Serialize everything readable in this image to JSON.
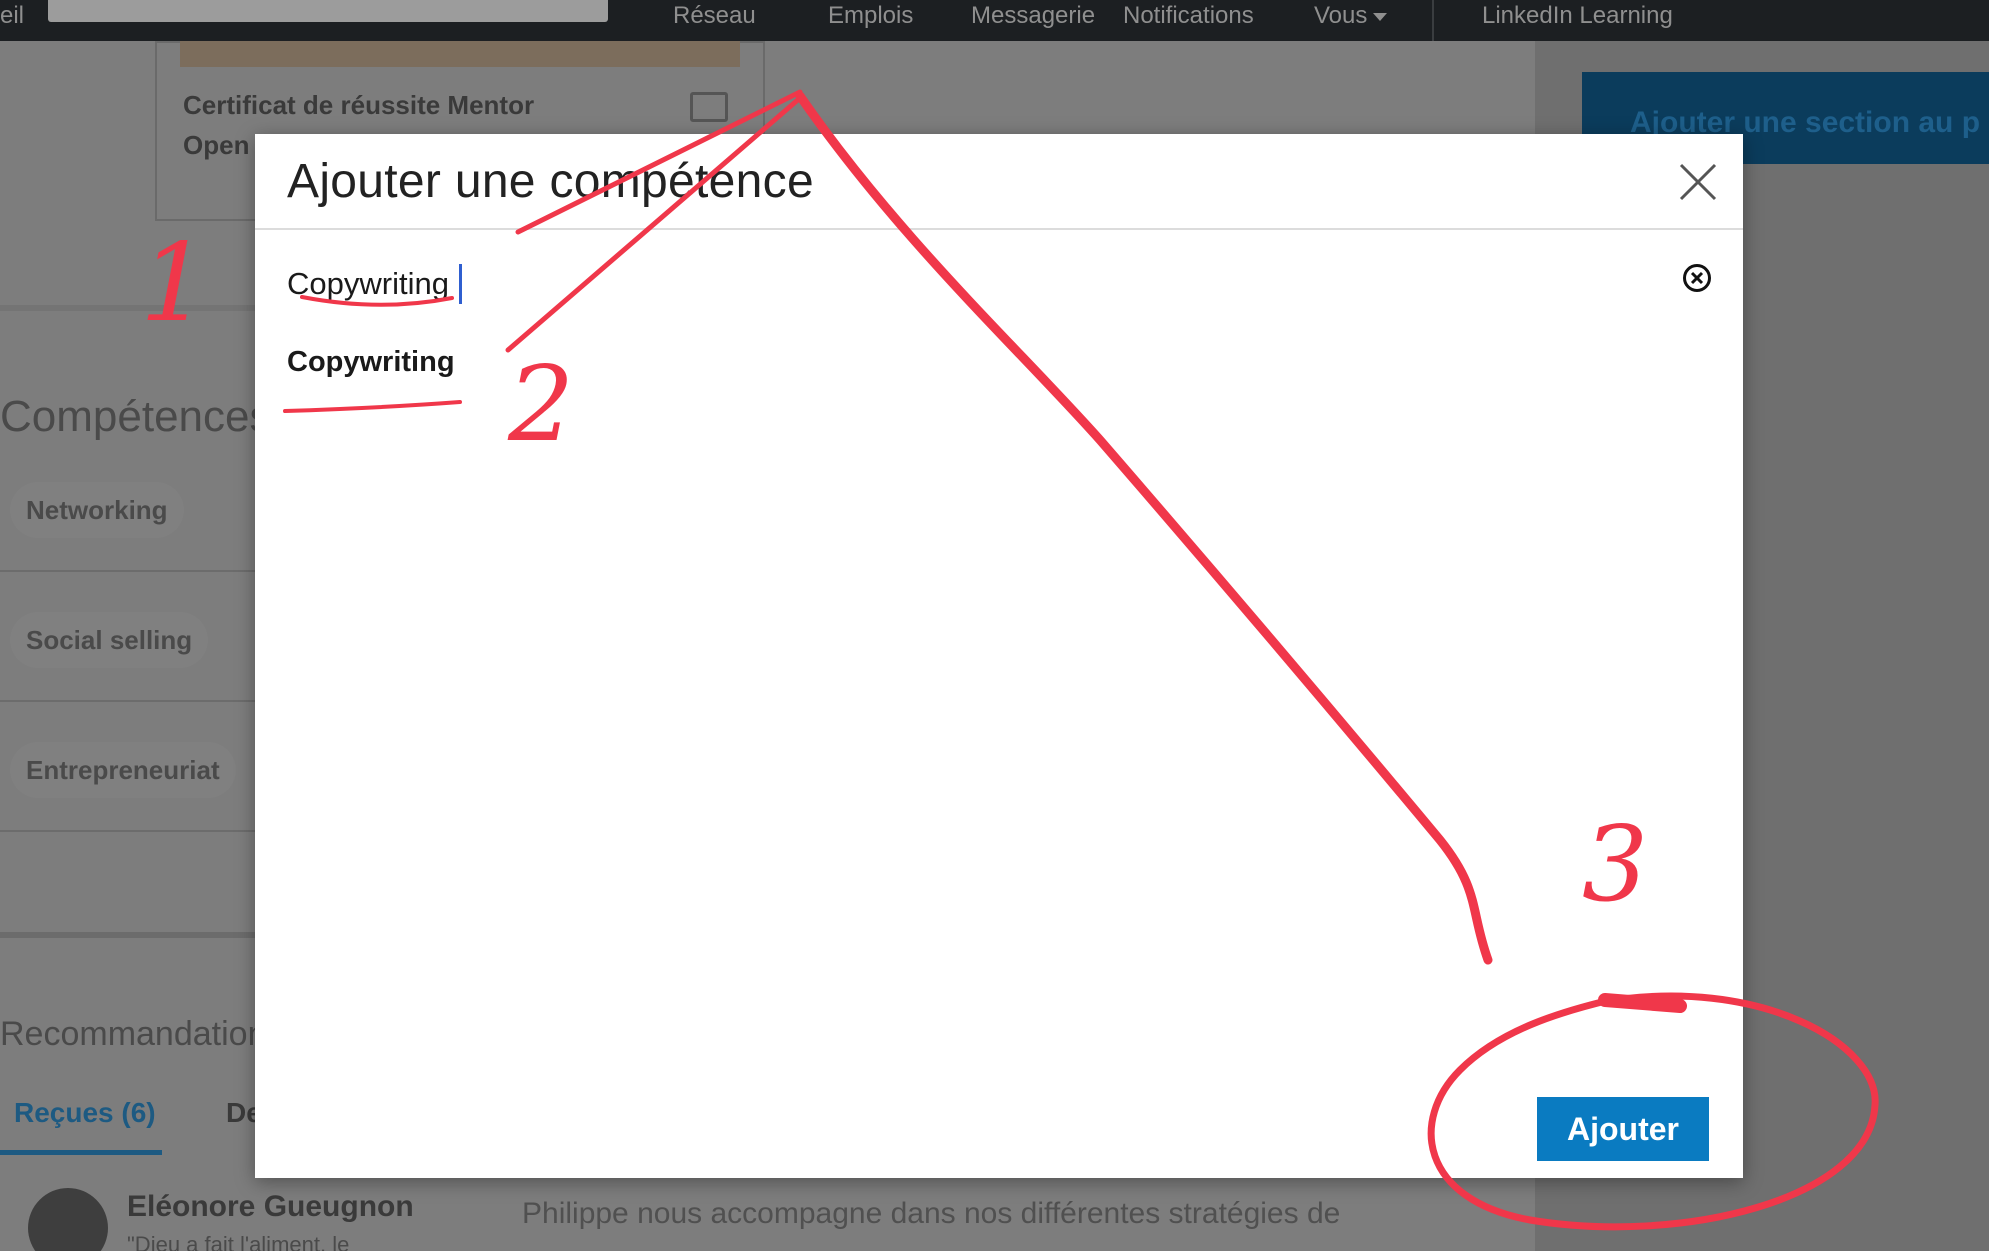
{
  "nav": {
    "home_fragment": "eil",
    "items": [
      "Réseau",
      "Emplois",
      "Messagerie",
      "Notifications",
      "Vous",
      "LinkedIn Learning"
    ]
  },
  "background": {
    "cert_title": "Certificat de réussite Mentor",
    "cert_sub": "Open",
    "skills_title": "Compétences et",
    "skills": [
      "Networking",
      "Social selling",
      "Entrepreneuriat"
    ],
    "reco_title": "Recommandations",
    "tabs": [
      "Reçues (6)",
      "De"
    ],
    "person_name": "Eléonore Gueugnon",
    "person_sub": "\"Dieu a fait l'aliment, le",
    "quote": "Philippe nous accompagne dans nos différentes stratégies de",
    "side_button": "Ajouter une section au p"
  },
  "modal": {
    "title": "Ajouter une compétence",
    "input_value": "Copywriting",
    "suggestion": "Copywriting",
    "add_button": "Ajouter"
  },
  "annotations": {
    "labels": [
      "1",
      "2",
      "3"
    ],
    "color": "#f0374a"
  },
  "colors": {
    "accent": "#0a7bc1",
    "nav_bg": "#1c1f22"
  },
  "icons": [
    "close-icon",
    "clear-circle-icon",
    "caret-down-icon"
  ]
}
